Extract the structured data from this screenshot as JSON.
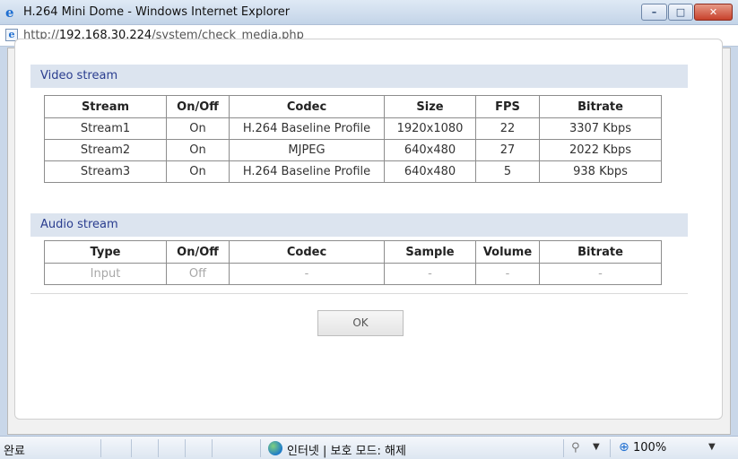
{
  "window": {
    "title": "H.264 Mini Dome - Windows Internet Explorer",
    "controls": {
      "minimize": "–",
      "maximize": "□",
      "close": "✕"
    }
  },
  "address": {
    "url_prefix": "http://",
    "url_host": "192.168.30.224",
    "url_path": "/system/check_media.php"
  },
  "video_stream": {
    "title": "Video stream",
    "columns": [
      "Stream",
      "On/Off",
      "Codec",
      "Size",
      "FPS",
      "Bitrate"
    ],
    "rows": [
      [
        "Stream1",
        "On",
        "H.264 Baseline Profile",
        "1920x1080",
        "22",
        "3307 Kbps"
      ],
      [
        "Stream2",
        "On",
        "MJPEG",
        "640x480",
        "27",
        "2022 Kbps"
      ],
      [
        "Stream3",
        "On",
        "H.264 Baseline Profile",
        "640x480",
        "5",
        "938 Kbps"
      ]
    ]
  },
  "audio_stream": {
    "title": "Audio stream",
    "columns": [
      "Type",
      "On/Off",
      "Codec",
      "Sample",
      "Volume",
      "Bitrate"
    ],
    "rows": [
      [
        "Input",
        "Off",
        "-",
        "-",
        "-",
        "-"
      ]
    ]
  },
  "dialog": {
    "ok_label": "OK"
  },
  "statusbar": {
    "status_text": "완료",
    "zone_text": "인터넷 | 보호 모드: 해제",
    "zoom_text": "100%"
  }
}
